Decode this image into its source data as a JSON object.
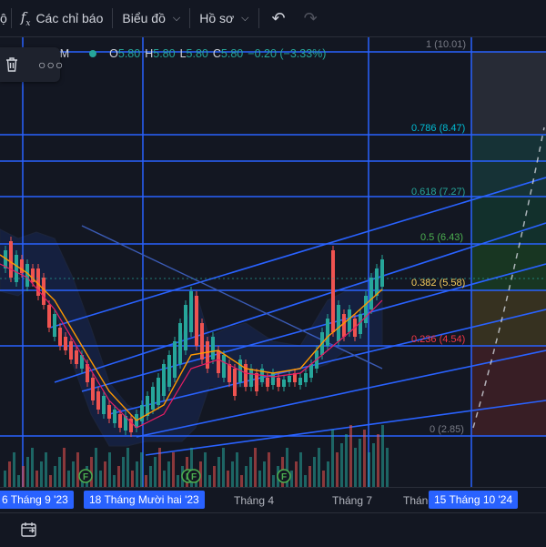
{
  "toolbar": {
    "left_glyph": "ộ",
    "indicators_label": "Các chỉ báo",
    "chart_label": "Biểu đồ",
    "profile_label": "Hồ sơ"
  },
  "ohlc": {
    "symbol_tail": "OM",
    "o_label": "O",
    "o_value": "5.80",
    "h_label": "H",
    "h_value": "5.80",
    "l_label": "L",
    "l_value": "5.80",
    "c_label": "C",
    "c_value": "5.80",
    "change": "−0.20 (−3.33%)"
  },
  "fib_levels": [
    {
      "label": "1 (10.01)",
      "color": "#787b86"
    },
    {
      "label": "0.786 (8.47)",
      "color": "#00bcd4"
    },
    {
      "label": "0.618 (7.27)",
      "color": "#26a69a"
    },
    {
      "label": "0.5 (6.43)",
      "color": "#4caf50"
    },
    {
      "label": "0.382 (5.58)",
      "color": "#f5cb5c"
    },
    {
      "label": "0.236 (4.54)",
      "color": "#f23645"
    },
    {
      "label": "0 (2.85)",
      "color": "#787b86"
    }
  ],
  "event_marker": "F",
  "xaxis": {
    "hl_left": "6 Tháng 9 '23",
    "hl_mid": "18 Tháng Mười hai '23",
    "t1": "Tháng 4",
    "t2": "Tháng 7",
    "t3": "Tháng",
    "hl_right": "15 Tháng 10 '24"
  },
  "colors": {
    "background": "#131722",
    "up": "#26a69a",
    "down": "#ef5350",
    "line_blue": "#2962ff"
  }
}
